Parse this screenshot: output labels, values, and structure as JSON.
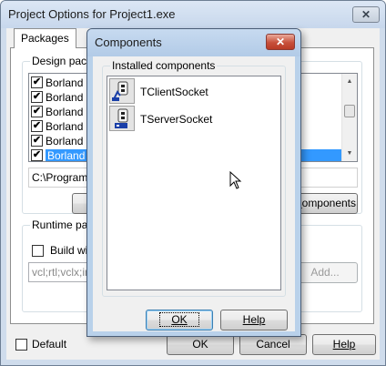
{
  "main_window": {
    "title": "Project Options for Project1.exe",
    "close_glyph": "✕",
    "tab": "Packages",
    "design_group_label": "Design packa",
    "packages": [
      {
        "label": "Borland M",
        "checked": true,
        "selected": false
      },
      {
        "label": "Borland Sa",
        "checked": true,
        "selected": false
      },
      {
        "label": "Borland Sa",
        "checked": true,
        "selected": false
      },
      {
        "label": "Borland Si",
        "checked": true,
        "selected": false
      },
      {
        "label": "Borland St",
        "checked": true,
        "selected": false
      },
      {
        "label": "Borland Sc",
        "checked": true,
        "selected": true
      }
    ],
    "check_glyph": "✔",
    "path_text": "C:\\Program F",
    "components_button": "Components",
    "components_button_prefix": "",
    "components_button_mnemonic": "C",
    "components_button_rest": "omponents",
    "runtime_group_label": "Runtime pack",
    "build_with_label": "Build with",
    "runtime_packages_value": "vcl;rtl;vclx;ind",
    "add_button": "Add...",
    "default_label": "Default",
    "ok_button": "OK",
    "cancel_button": "Cancel",
    "help_button": "Help"
  },
  "components_dialog": {
    "title": "Components",
    "close_glyph": "✕",
    "group_label": "Installed components",
    "items": [
      {
        "label": "TClientSocket",
        "icon": "client-socket-icon"
      },
      {
        "label": "TServerSocket",
        "icon": "server-socket-icon"
      }
    ],
    "ok_button": "OK",
    "help_button": "Help"
  },
  "colors": {
    "selection": "#3399ff",
    "dialog_frame": "#b9d1ea",
    "close_button": "#c8503b"
  }
}
